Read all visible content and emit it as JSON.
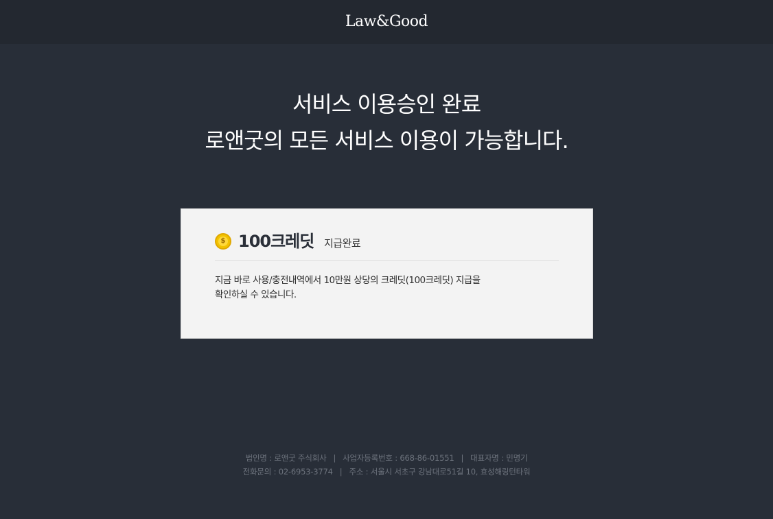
{
  "header": {
    "logo_text": "Law&Good"
  },
  "hero": {
    "title_line1": "서비스 이용승인 완료",
    "title_line2": "로앤굿의 모든 서비스 이용이 가능합니다."
  },
  "credit_card": {
    "icon": "coin-dollar-icon",
    "amount_label": "100크레딧",
    "status_label": "지급완료",
    "description_line1": "지금 바로 사용/충전내역에서 10만원 상당의 크레딧(100크레딧) 지급을",
    "description_line2": "확인하실 수 있습니다."
  },
  "footer": {
    "company_name": "법인명 : 로앤굿 주식회사",
    "business_number": "사업자등록번호 : 668-86-01551",
    "ceo": "대표자명 : 민명기",
    "phone": "전화문의 : 02-6953-3774",
    "address": "주소 : 서울시 서초구 강남대로51길 10, 효성해링턴타워",
    "separator": "|"
  },
  "colors": {
    "background": "#282e38",
    "topbar": "#232830",
    "card": "#f3f3f3",
    "coin": "#f2c200"
  }
}
